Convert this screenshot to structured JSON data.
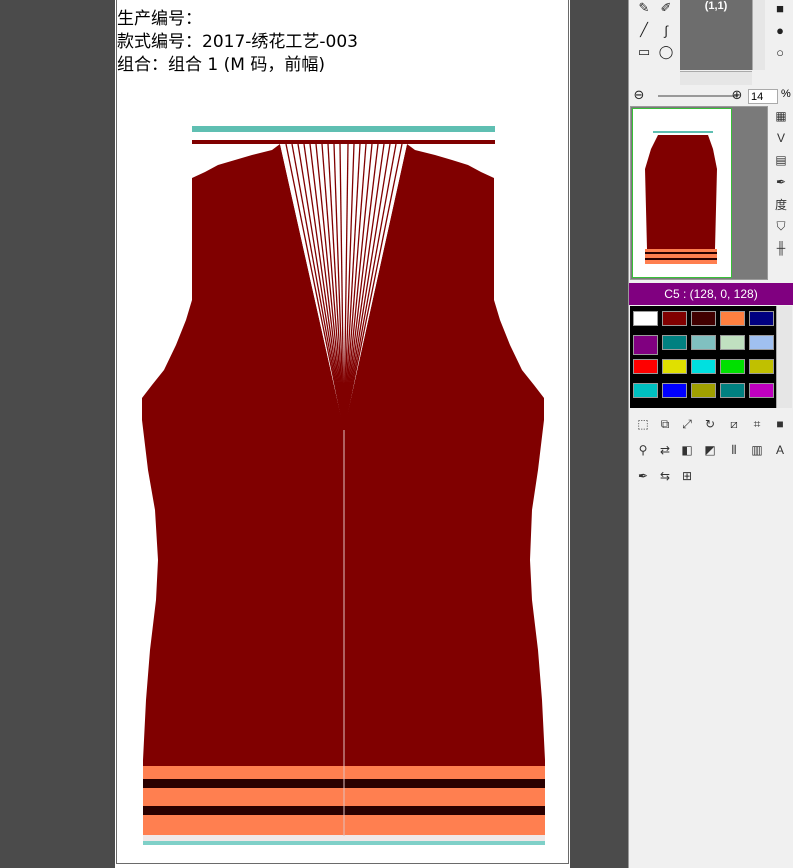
{
  "document": {
    "info_lines": [
      "生产编号：",
      "款式编号：2017-绣花工艺-003",
      "组合：组合 1 (M 码，前幅)"
    ]
  },
  "navigator": {
    "coord_label": "(1,1)",
    "zoom_value": "14",
    "zoom_unit": "%"
  },
  "color_panel": {
    "selected_label": "C5 : (128, 0, 128)",
    "swatches": [
      "#ffffff",
      "#800000",
      "#400000",
      "#ff8040",
      "#000080",
      "#800080",
      "#008080",
      "#80c0c0",
      "#c0e0c0",
      "#a0c0f0",
      "#ff0000",
      "#e0e000",
      "#00e0e0",
      "#00e000",
      "#c0c000",
      "#00c0c0",
      "#0000ff",
      "#a0a000",
      "#008080",
      "#c000c0"
    ]
  },
  "colors": {
    "garment_body": "#800000",
    "rib_stripe_orange": "#ff7f50",
    "rib_stripe_dark": "#2a0000",
    "neckband_teal": "#5fbfb2",
    "panel_accent": "#800080"
  }
}
